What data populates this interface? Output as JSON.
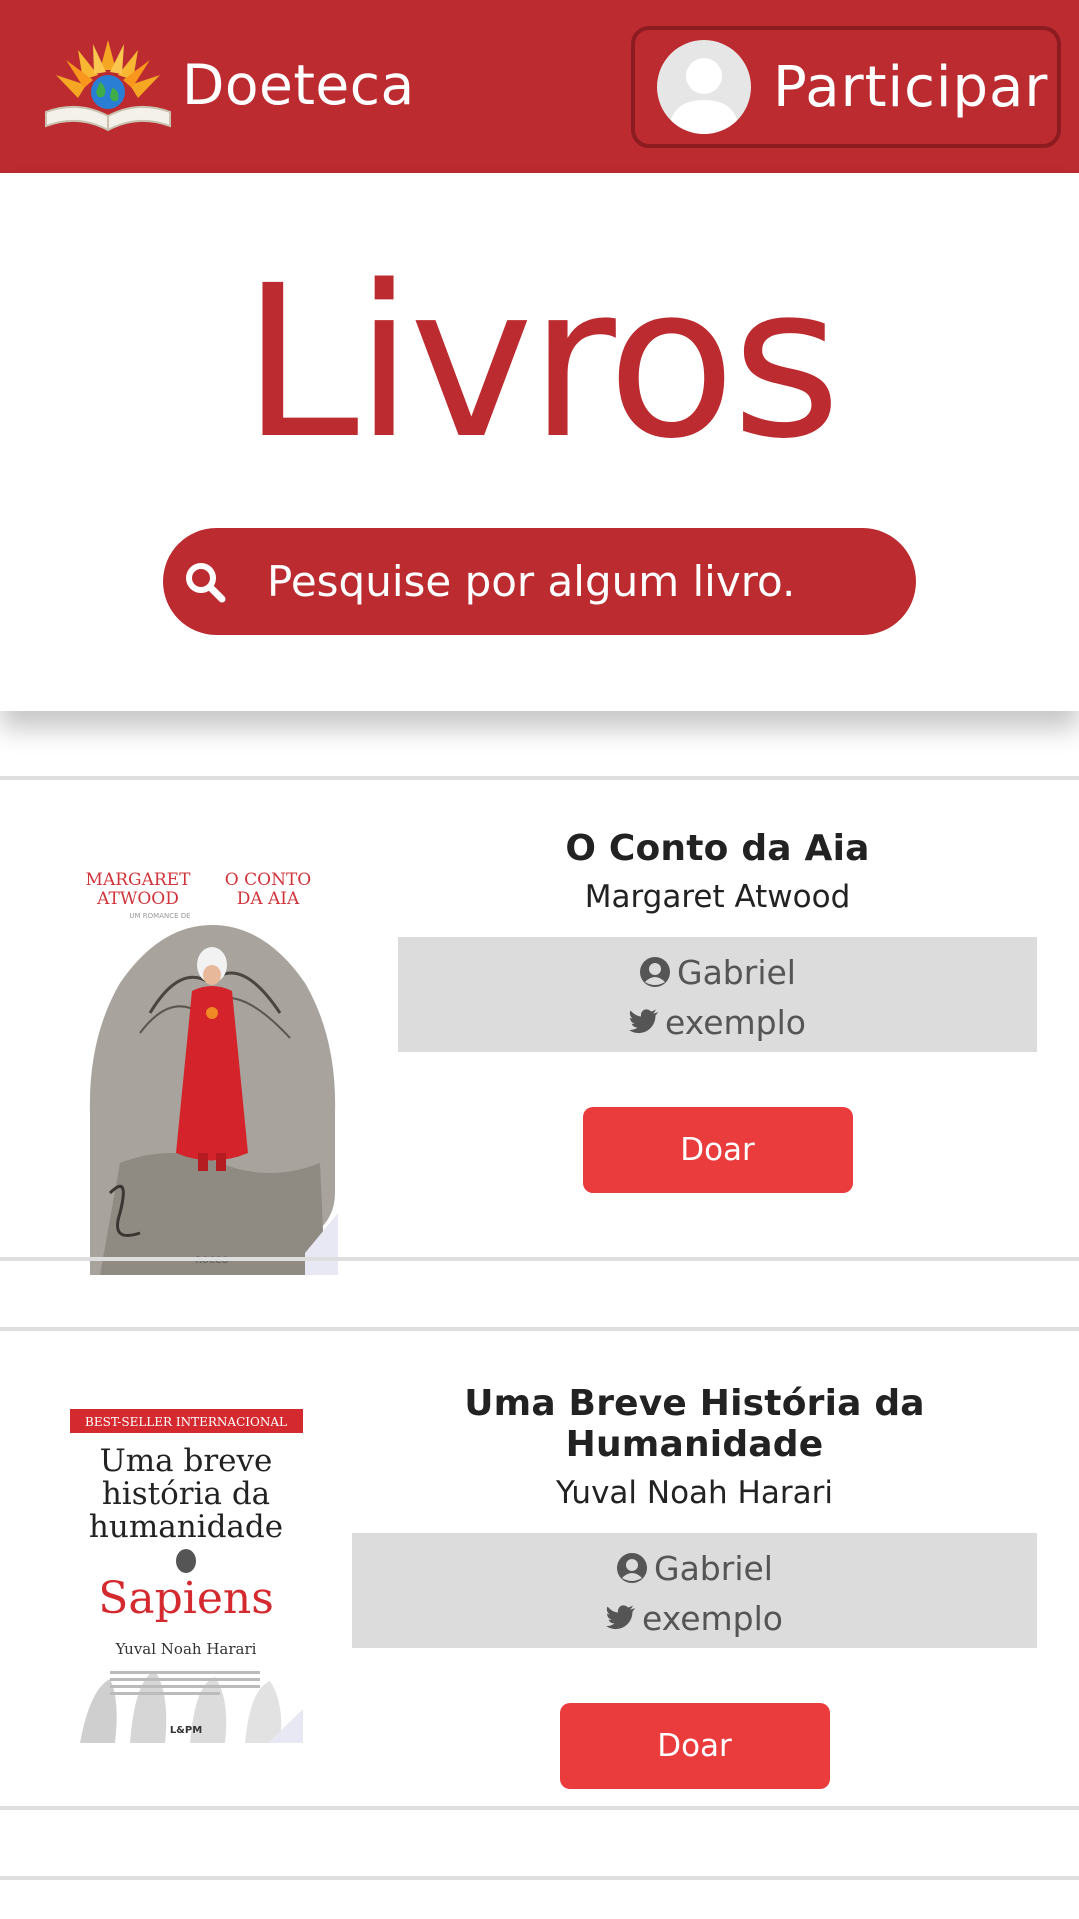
{
  "navbar": {
    "brand_name": "Doeteca",
    "participar_label": "Participar"
  },
  "hero": {
    "title": "Livros",
    "search_placeholder": "Pesquise por algum livro."
  },
  "books": [
    {
      "title": "O Conto da Aia",
      "author": "Margaret Atwood",
      "donor_name": "Gabriel",
      "donor_twitter": "exemplo",
      "button_label": "Doar",
      "cover": {
        "line1_left": "MARGARET",
        "line1_right": "O CONTO",
        "line2_left": "ATWOOD",
        "line2_right": "DA AIA",
        "tagline": "UM ROMANCE DE",
        "publisher": "ROCCO"
      }
    },
    {
      "title": "Uma Breve História da Humanidade",
      "author": "Yuval Noah Harari",
      "donor_name": "Gabriel",
      "donor_twitter": "exemplo",
      "button_label": "Doar",
      "cover": {
        "banner": "BEST-SELLER INTERNACIONAL",
        "title_line1": "Uma breve",
        "title_line2": "história da",
        "title_line3": "humanidade",
        "subtitle": "Sapiens",
        "author": "Yuval Noah Harari",
        "publisher": "L&PM"
      }
    }
  ],
  "colors": {
    "primary": "#bb2b30",
    "button": "#ea3b3d",
    "donor_box": "#dcdcdc"
  }
}
